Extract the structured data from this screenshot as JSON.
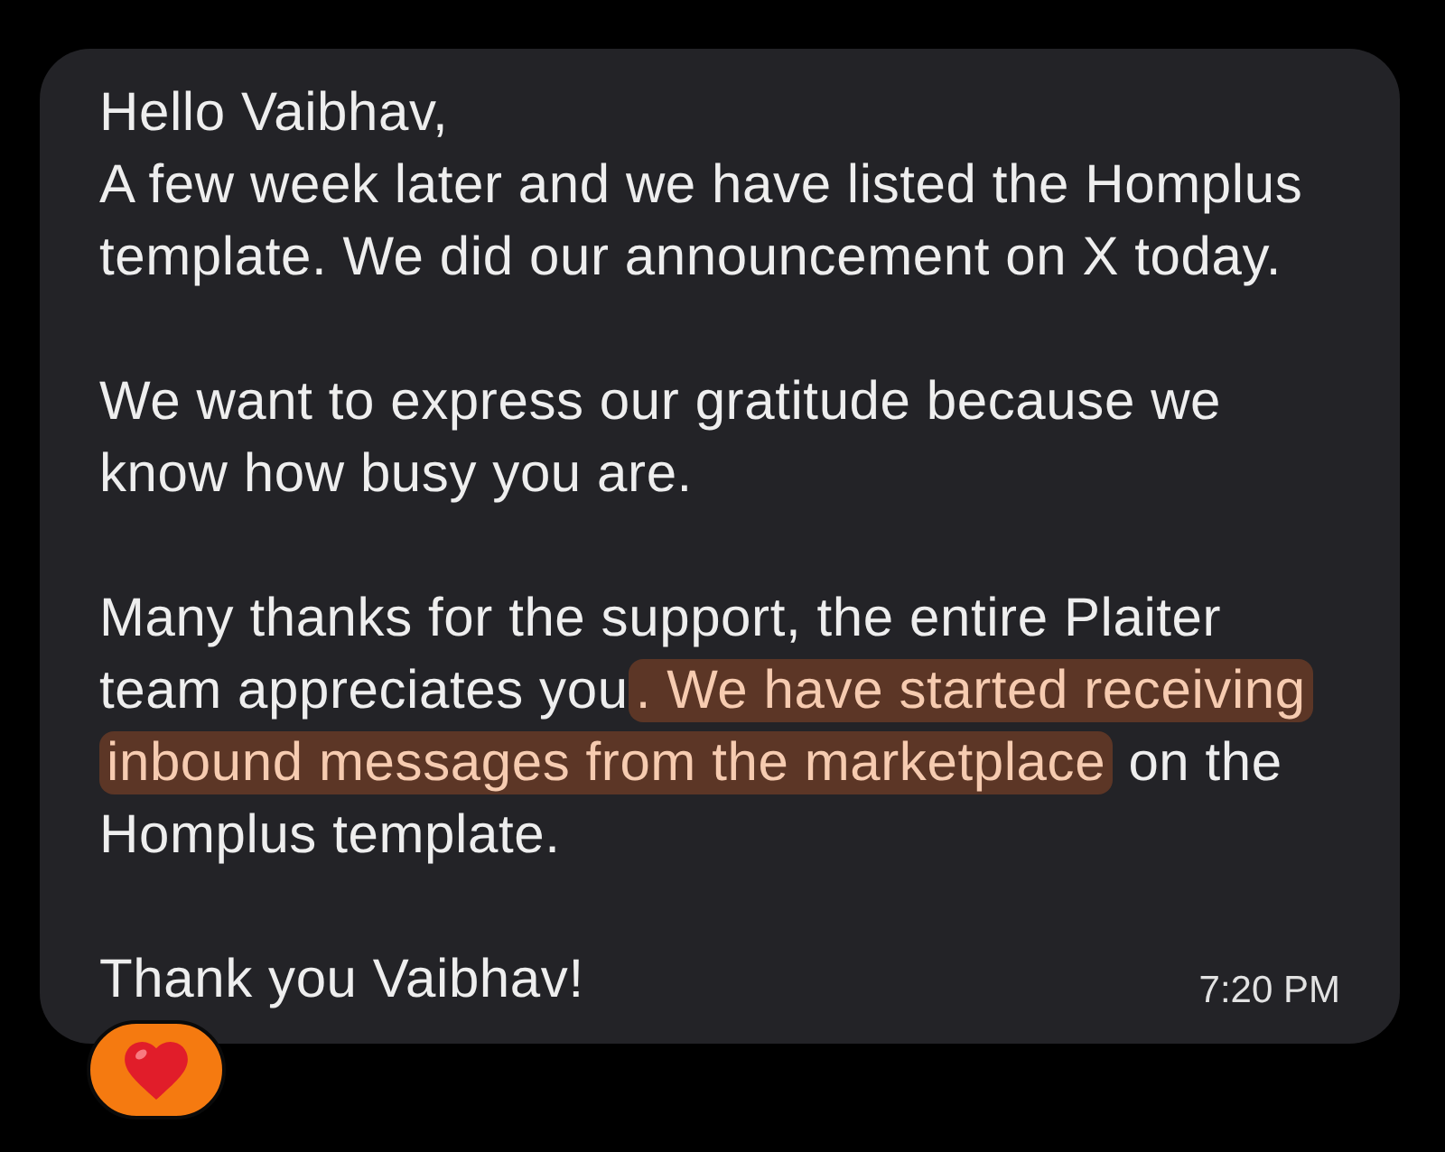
{
  "message": {
    "greeting": "Hello Vaibhav,",
    "paragraphs": [
      {
        "segments": [
          {
            "text": "A few week later and we have listed the Homplus template. We did our announcement on X today.",
            "highlighted": false
          }
        ]
      },
      {
        "segments": [
          {
            "text": "We want to express our gratitude because we know how busy you are.",
            "highlighted": false
          }
        ]
      },
      {
        "segments": [
          {
            "text": "Many thanks for the support, the entire Plaiter team appreciates you",
            "highlighted": false
          },
          {
            "text": ". We have started receiving inbound messages from the marketplace",
            "highlighted": true
          },
          {
            "text": " on the Homplus template.",
            "highlighted": false
          }
        ]
      }
    ],
    "closing": "Thank you Vaibhav!",
    "time": "7:20 PM"
  },
  "reactions": [
    {
      "kind": "heart"
    }
  ]
}
